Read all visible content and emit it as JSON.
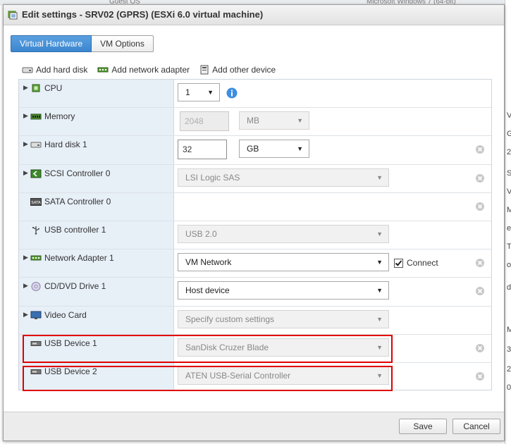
{
  "background": {
    "top_text": "Guest OS",
    "top_text_2": "Microsoft Windows 7 (64-bit)",
    "right_letters": [
      "V",
      "G",
      "2",
      "S",
      "V",
      "M",
      "e",
      "T",
      "o",
      "d",
      "M",
      "3",
      "2",
      "0"
    ]
  },
  "dialog": {
    "title": "Edit settings - SRV02 (GPRS) (ESXi 6.0 virtual machine)",
    "tabs": [
      {
        "label": "Virtual Hardware",
        "active": true
      },
      {
        "label": "VM Options",
        "active": false
      }
    ],
    "add_bar": {
      "hard_disk": "Add hard disk",
      "network_adapter": "Add network adapter",
      "other_device": "Add other device"
    },
    "devices": [
      {
        "label": "CPU",
        "icon": "cpu-icon",
        "value": "1"
      },
      {
        "label": "Memory",
        "icon": "memory-icon",
        "value": "2048",
        "unit": "MB"
      },
      {
        "label": "Hard disk 1",
        "icon": "hard-disk-icon",
        "value": "32",
        "unit": "GB"
      },
      {
        "label": "SCSI Controller 0",
        "icon": "scsi-icon",
        "value": "LSI Logic SAS"
      },
      {
        "label": "SATA Controller 0",
        "icon": "sata-icon",
        "badge": "SATA"
      },
      {
        "label": "USB controller 1",
        "icon": "usb-icon",
        "value": "USB 2.0"
      },
      {
        "label": "Network Adapter 1",
        "icon": "network-adapter-icon",
        "value": "VM Network",
        "connect_label": "Connect"
      },
      {
        "label": "CD/DVD Drive 1",
        "icon": "cd-dvd-icon",
        "value": "Host device"
      },
      {
        "label": "Video Card",
        "icon": "video-card-icon",
        "value": "Specify custom settings"
      },
      {
        "label": "USB Device 1",
        "icon": "usb-device-icon",
        "value": "SanDisk Cruzer Blade"
      },
      {
        "label": "USB Device 2",
        "icon": "usb-device-icon",
        "value": "ATEN USB-Serial Controller"
      }
    ],
    "buttons": {
      "save": "Save",
      "cancel": "Cancel"
    }
  },
  "colors": {
    "tab_active": "#3b86d0",
    "highlight": "#e00000",
    "label_bg": "#e7eff7",
    "info": "#3d8ee0"
  }
}
